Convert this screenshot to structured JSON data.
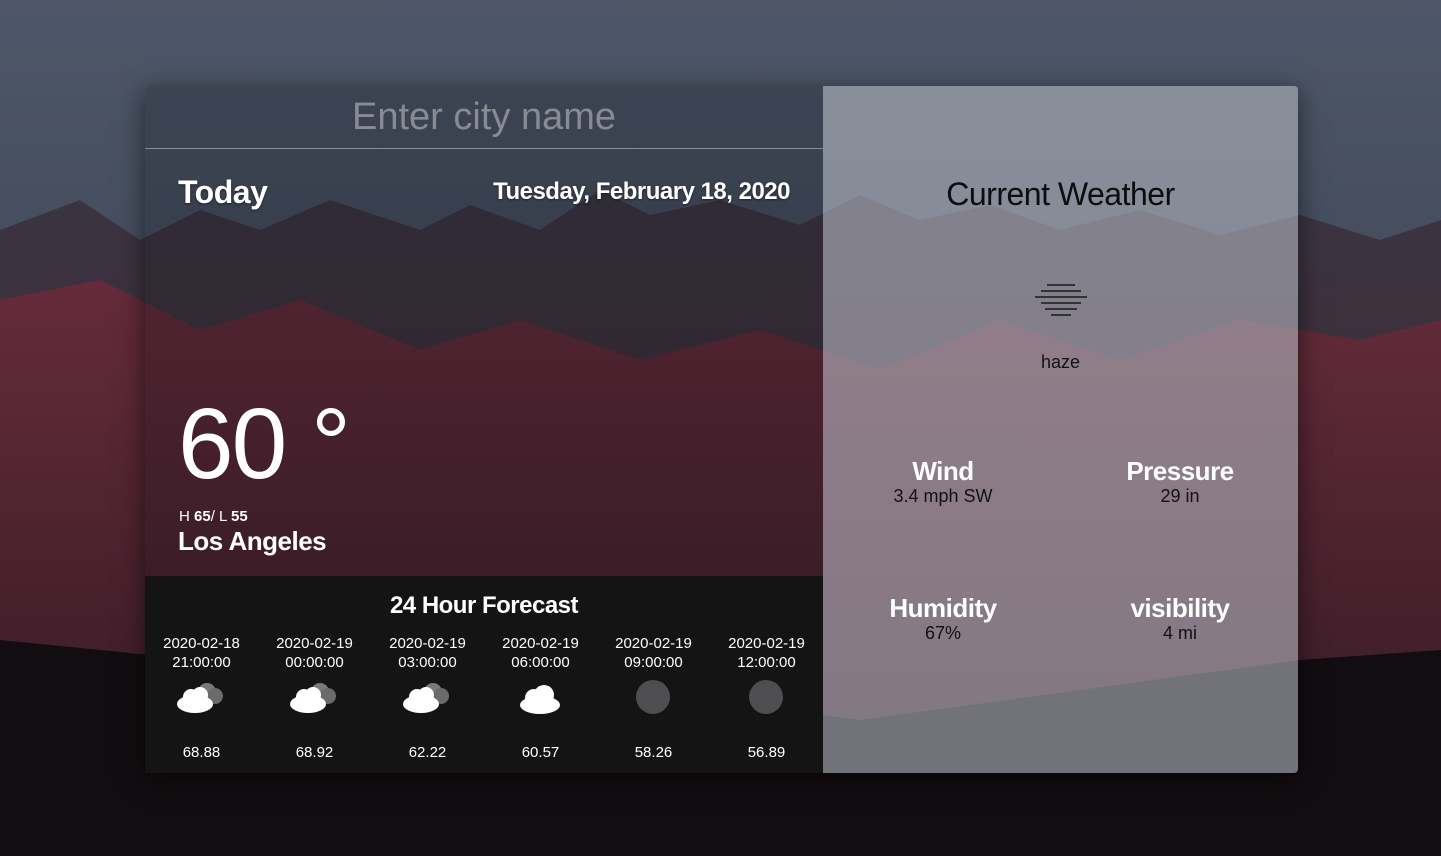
{
  "search": {
    "placeholder": "Enter city name"
  },
  "today": {
    "label": "Today",
    "date": "Tuesday, February 18, 2020",
    "temperature": "60 °",
    "high_prefix": "H",
    "high": "65",
    "low_prefix": "/ L",
    "low": "55",
    "city": "Los Angeles"
  },
  "forecast": {
    "title": "24 Hour Forecast",
    "items": [
      {
        "date": "2020-02-18",
        "time": "21:00:00",
        "icon": "partly-cloudy-night-icon",
        "temp": "68.88"
      },
      {
        "date": "2020-02-19",
        "time": "00:00:00",
        "icon": "partly-cloudy-night-icon",
        "temp": "68.92"
      },
      {
        "date": "2020-02-19",
        "time": "03:00:00",
        "icon": "partly-cloudy-night-icon",
        "temp": "62.22"
      },
      {
        "date": "2020-02-19",
        "time": "06:00:00",
        "icon": "cloud-icon",
        "temp": "60.57"
      },
      {
        "date": "2020-02-19",
        "time": "09:00:00",
        "icon": "moon-icon",
        "temp": "58.26"
      },
      {
        "date": "2020-02-19",
        "time": "12:00:00",
        "icon": "moon-icon",
        "temp": "56.89"
      }
    ]
  },
  "current": {
    "title": "Current Weather",
    "icon": "haze-icon",
    "condition": "haze",
    "wind_label": "Wind",
    "wind_value": "3.4 mph SW",
    "pressure_label": "Pressure",
    "pressure_value": "29 in",
    "humidity_label": "Humidity",
    "humidity_value": "67%",
    "visibility_label": "visibility",
    "visibility_value": "4 mi"
  },
  "colors": {
    "forecast_bg": "#151415",
    "panel_tint": "#afb2bc"
  }
}
